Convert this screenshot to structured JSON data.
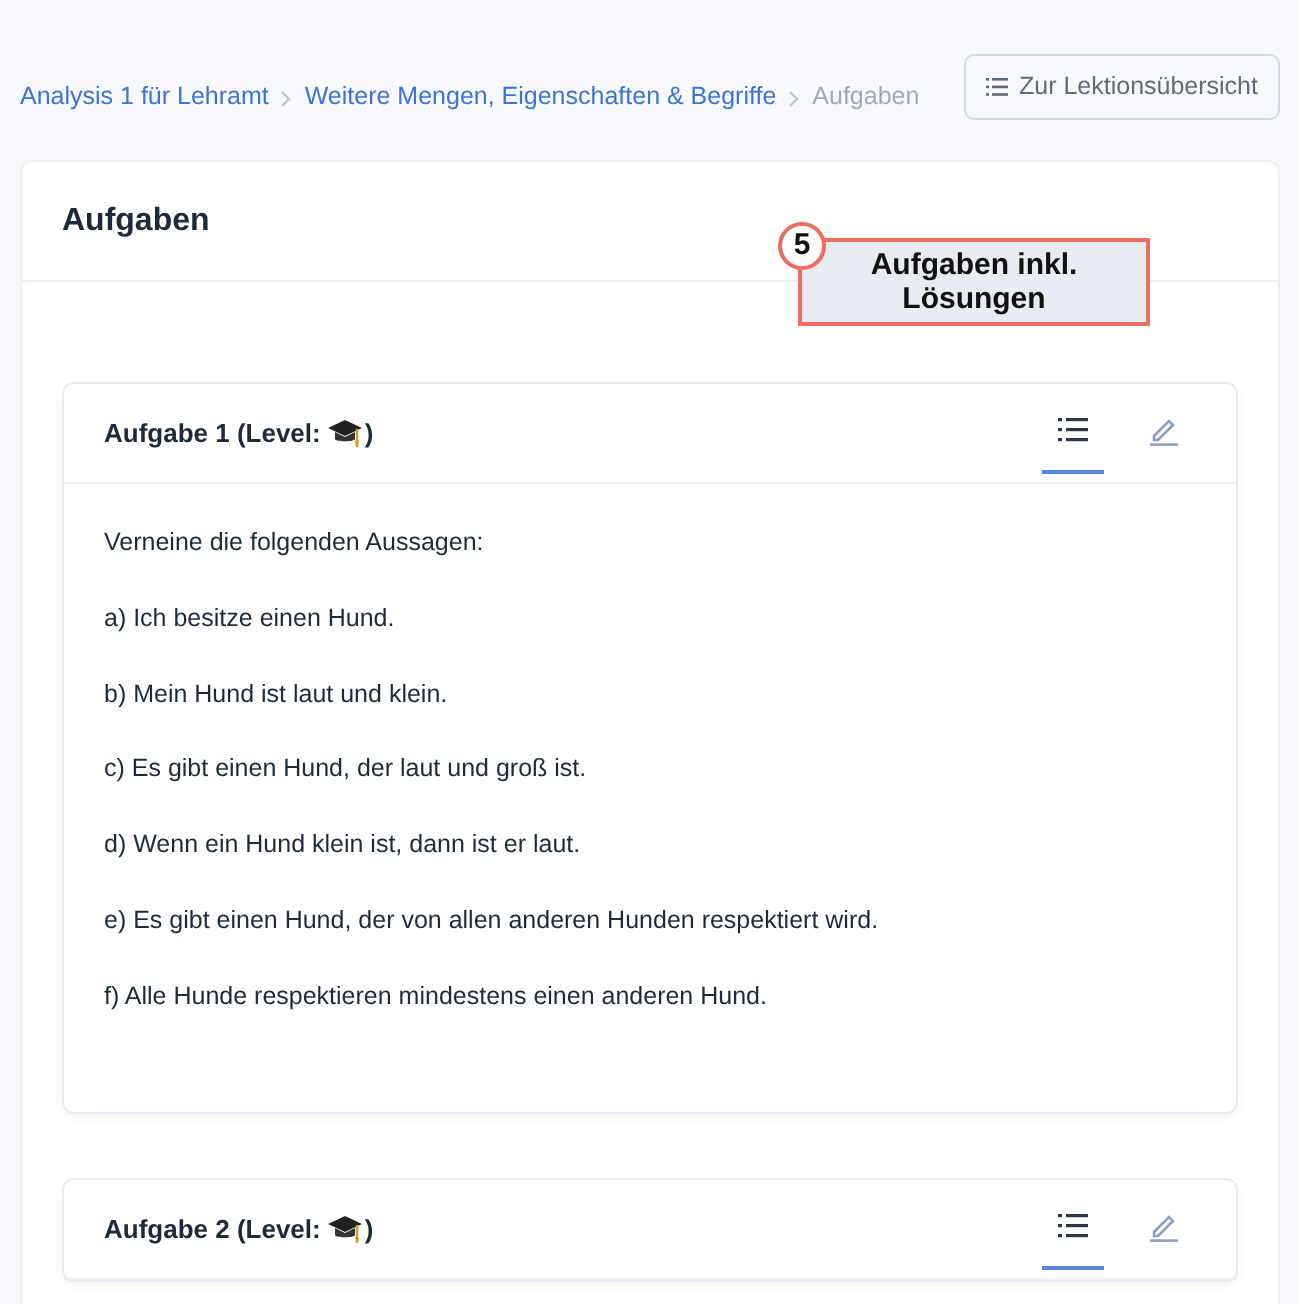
{
  "breadcrumb": [
    {
      "label": "Analysis 1 für Lehramt",
      "current": false
    },
    {
      "label": "Weitere Mengen, Eigenschaften & Begriffe",
      "current": false
    },
    {
      "label": "Aufgaben",
      "current": true
    }
  ],
  "overview_button": "Zur Lektionsübersicht",
  "section_title": "Aufgaben",
  "annotation": {
    "number": "5",
    "text": "Aufgaben inkl. Lösungen"
  },
  "tasks": [
    {
      "title": "Aufgabe 1 (Level:",
      "title_end": ")",
      "tabs": [
        {
          "kind": "list",
          "selected": true
        },
        {
          "kind": "edit",
          "selected": false
        }
      ],
      "lines": [
        "Verneine die folgenden Aussagen:",
        "a) Ich besitze einen Hund.",
        "b) Mein Hund ist laut und klein.",
        "c) Es gibt einen Hund, der laut und groß ist.",
        "d) Wenn ein Hund klein ist, dann ist er laut.",
        "e) Es gibt einen Hund, der von allen anderen Hunden respektiert wird.",
        "f) Alle Hunde respektieren mindestens einen anderen Hund."
      ]
    },
    {
      "title": "Aufgabe 2 (Level:",
      "title_end": ")",
      "tabs": [
        {
          "kind": "list",
          "selected": true
        },
        {
          "kind": "edit",
          "selected": false
        }
      ]
    }
  ]
}
